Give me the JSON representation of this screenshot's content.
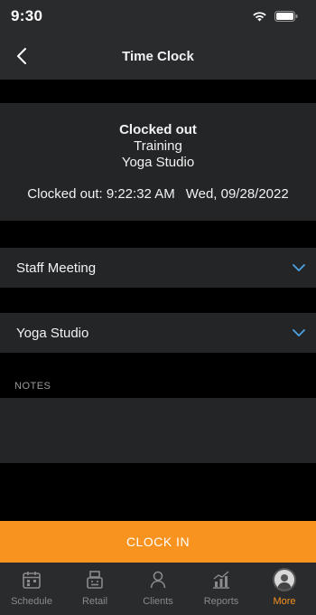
{
  "status_bar": {
    "time": "9:30"
  },
  "nav": {
    "title": "Time Clock"
  },
  "clock_status": {
    "state": "Clocked out",
    "class_name": "Training",
    "location": "Yoga Studio",
    "clocked_out_label": "Clocked out: 9:22:32 AM",
    "date": "Wed, 09/28/2022"
  },
  "selects": {
    "job": "Staff Meeting",
    "location": "Yoga Studio"
  },
  "notes": {
    "label": "NOTES",
    "value": ""
  },
  "clock_in_label": "CLOCK IN",
  "colors": {
    "accent": "#f7931e",
    "chevron": "#4da3e0"
  },
  "tabs": [
    {
      "label": "Schedule",
      "icon": "calendar-icon"
    },
    {
      "label": "Retail",
      "icon": "register-icon"
    },
    {
      "label": "Clients",
      "icon": "person-icon"
    },
    {
      "label": "Reports",
      "icon": "chart-icon"
    },
    {
      "label": "More",
      "icon": "avatar",
      "active": true
    }
  ]
}
